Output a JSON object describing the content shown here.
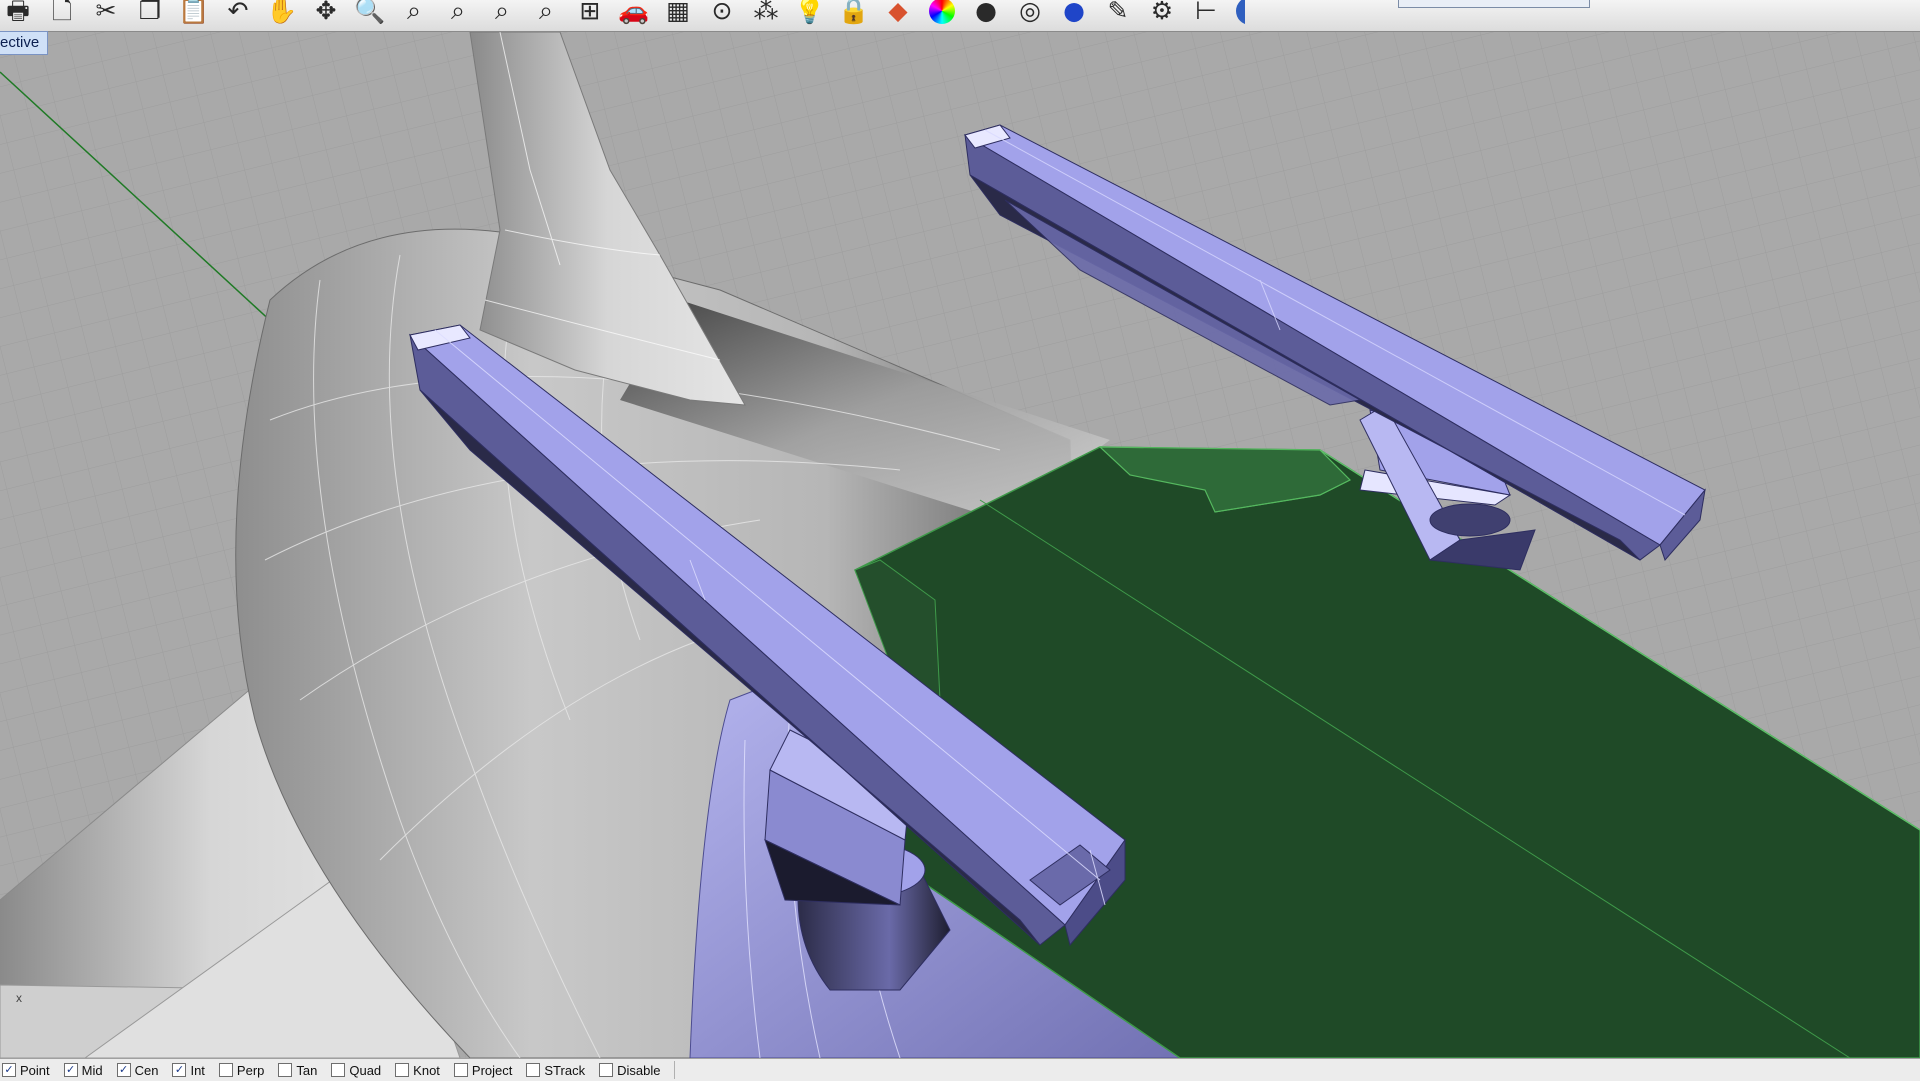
{
  "viewport": {
    "title": "ective",
    "axis_label": "x"
  },
  "toolbar": {
    "buttons": [
      {
        "name": "print-icon",
        "glyph": "🖶"
      },
      {
        "name": "new-document-icon",
        "glyph": "🗋"
      },
      {
        "name": "cut-icon",
        "glyph": "✂"
      },
      {
        "name": "copy-icon",
        "glyph": "❐"
      },
      {
        "name": "paste-icon",
        "glyph": "📋"
      },
      {
        "name": "undo-icon",
        "glyph": "↶"
      },
      {
        "name": "pan-hand-icon",
        "glyph": "✋"
      },
      {
        "name": "rotate-view-icon",
        "glyph": "✥"
      },
      {
        "name": "zoom-dynamic-icon",
        "glyph": "🔍"
      },
      {
        "name": "zoom-window-icon",
        "glyph": "⌕"
      },
      {
        "name": "zoom-extents-icon",
        "glyph": "⌕"
      },
      {
        "name": "zoom-selected-icon",
        "glyph": "⌕"
      },
      {
        "name": "zoom-target-icon",
        "glyph": "⌕"
      },
      {
        "name": "four-viewports-icon",
        "glyph": "⊞"
      },
      {
        "name": "car-icon",
        "glyph": "🚗"
      },
      {
        "name": "grid-plane-icon",
        "glyph": "▦"
      },
      {
        "name": "osnap-icon",
        "glyph": "⊙"
      },
      {
        "name": "select-points-icon",
        "glyph": "⁂"
      },
      {
        "name": "light-bulb-icon",
        "glyph": "💡"
      },
      {
        "name": "lock-icon",
        "glyph": "🔒"
      },
      {
        "name": "layers-icon",
        "glyph": "◆"
      },
      {
        "name": "color-wheel-icon",
        "glyph": "◍"
      },
      {
        "name": "shaded-sphere-icon",
        "glyph": "●"
      },
      {
        "name": "wire-sphere-icon",
        "glyph": "◎"
      },
      {
        "name": "rendered-sphere-icon",
        "glyph": "●"
      },
      {
        "name": "pen-icon",
        "glyph": "✎"
      },
      {
        "name": "options-gear-icon",
        "glyph": "⚙"
      },
      {
        "name": "dimension-icon",
        "glyph": "⊢"
      },
      {
        "name": "help-icon",
        "glyph": "?"
      }
    ]
  },
  "osnaps": [
    {
      "label": "Point",
      "checked": true
    },
    {
      "label": "Mid",
      "checked": true
    },
    {
      "label": "Cen",
      "checked": true
    },
    {
      "label": "Int",
      "checked": true
    },
    {
      "label": "Perp",
      "checked": false
    },
    {
      "label": "Tan",
      "checked": false
    },
    {
      "label": "Quad",
      "checked": false
    },
    {
      "label": "Knot",
      "checked": false
    },
    {
      "label": "Project",
      "checked": false
    },
    {
      "label": "STrack",
      "checked": false
    },
    {
      "label": "Disable",
      "checked": false
    }
  ],
  "colors": {
    "grid_background": "#a9a9a9",
    "grid_line": "#9a9a9a",
    "hull_grey": "#b4b4b4",
    "selected_lavender": "#a2a2ea",
    "selected_dark": "#5c5c98",
    "green_body": "#1f4a27",
    "green_edge": "#3f9a4a",
    "axis_green": "#1f7a25"
  }
}
